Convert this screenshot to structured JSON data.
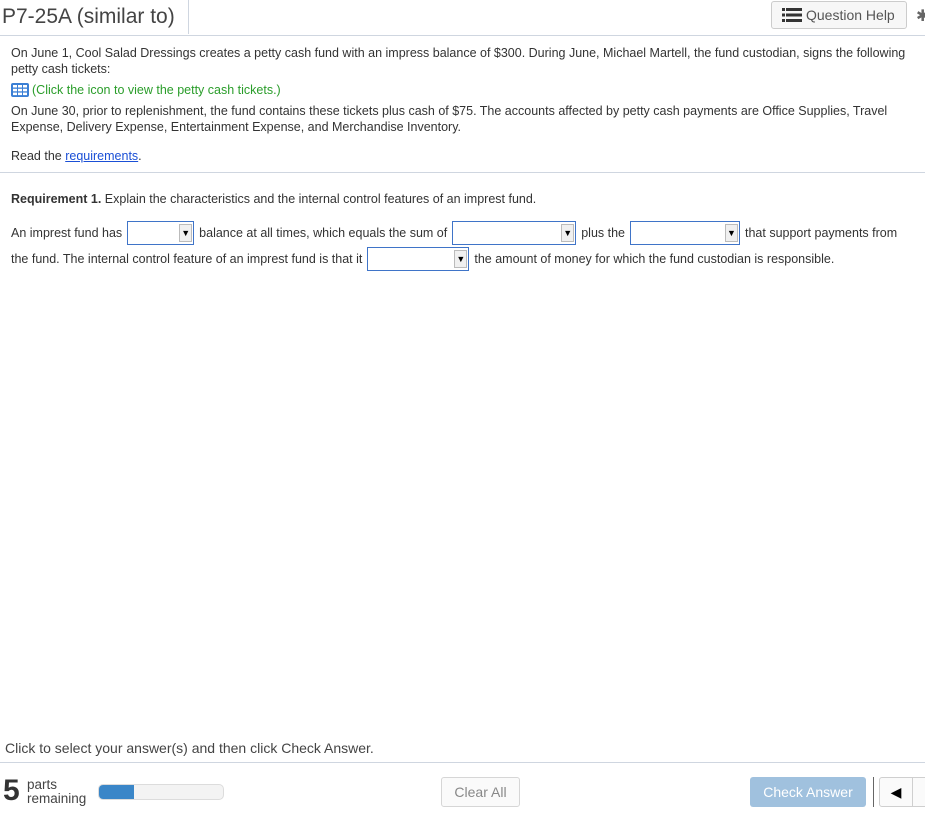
{
  "header": {
    "title": "P7-25A (similar to)",
    "question_help_label": "Question Help",
    "question_help_icon": "list-icon",
    "settings_icon": "gear-icon"
  },
  "problem": {
    "paragraph1": "On June 1, Cool Salad Dressings creates a petty cash fund with an impress balance of $300. During June, Michael Martell, the fund custodian, signs the following petty cash tickets:",
    "tickets_link_icon": "table-icon",
    "tickets_link_text": "(Click the icon to view the petty cash tickets.)",
    "paragraph2": "On June 30, prior to replenishment, the fund contains these tickets plus cash of $75. The accounts affected by petty cash payments are Office Supplies, Travel Expense, Delivery Expense, Entertainment Expense, and Merchandise Inventory.",
    "read_prefix": "Read the ",
    "requirements_link": "requirements",
    "read_suffix": "."
  },
  "requirement": {
    "label": "Requirement 1.",
    "text": " Explain the characteristics and the internal control features of an imprest fund."
  },
  "answer": {
    "line1": {
      "seg1": "An imprest fund has",
      "seg2": "balance at all times, which equals the sum of",
      "seg3": "plus the",
      "seg4": "that support payments from"
    },
    "line2": {
      "seg1": "the fund. The internal control feature of an imprest fund is that it",
      "seg2": "the amount of money for which the fund custodian is responsible."
    },
    "dropdowns": [
      {
        "selected": ""
      },
      {
        "selected": ""
      },
      {
        "selected": ""
      },
      {
        "selected": ""
      }
    ]
  },
  "footer": {
    "instruction": "Click to select your answer(s) and then click Check Answer.",
    "parts_remaining_count": "5",
    "parts_label_line1": "parts",
    "parts_label_line2": "remaining",
    "progress_fraction": 0.28,
    "clear_all_label": "Clear All",
    "check_answer_label": "Check Answer",
    "prev_icon": "triangle-left-icon"
  }
}
